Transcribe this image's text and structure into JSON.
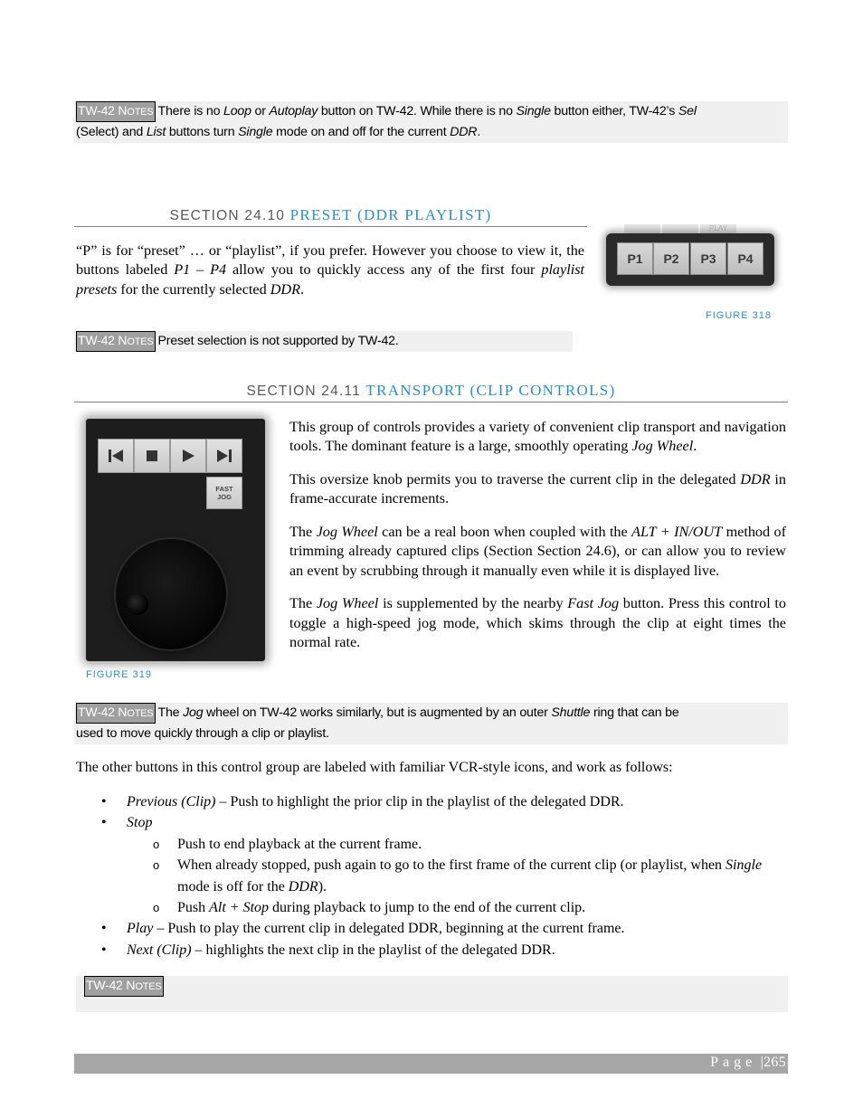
{
  "note_label": "TW-42 N",
  "note_label_sc": "OTES",
  "note1": {
    "t1": "There is no ",
    "i1": "Loop",
    "t2": " or ",
    "i2": "Autoplay",
    "t3": " button on TW-42.  While there is no ",
    "i3": "Single",
    "t4": " button either, TW-42’s ",
    "i4": "Sel",
    "t5": "(Select) and ",
    "i5": "List",
    "t6": " buttons turn ",
    "i6": "Single",
    "t7": " mode on and off for the current ",
    "i7": "DDR",
    "t8": "."
  },
  "section_2410": {
    "prefix": "SECTION 24.10 ",
    "title": "PRESET (DDR PLAYLIST)"
  },
  "preset_para": {
    "t1": "“P” is for “preset” … or “playlist”, if you prefer.  However you choose to view it, the buttons labeled ",
    "i1": "P1 – P4",
    "t2": " allow you to quickly access any of the first four ",
    "i2": "playlist presets",
    "t3": " for the currently selected ",
    "i3": "DDR",
    "t4": "."
  },
  "figure_318": {
    "caption": "FIGURE 318",
    "top_label": "PLAY",
    "buttons": [
      "P1",
      "P2",
      "P3",
      "P4"
    ]
  },
  "note2": {
    "text": "Preset selection is not supported by TW-42."
  },
  "section_2411": {
    "prefix": "SECTION 24.11 ",
    "title": "TRANSPORT (CLIP CONTROLS)"
  },
  "figure_319": {
    "caption": "FIGURE 319",
    "fast_jog_line1": "FAST",
    "fast_jog_line2": "JOG",
    "buttons": [
      "previous-icon",
      "stop-icon",
      "play-icon",
      "next-icon"
    ]
  },
  "transport_paras": {
    "p1_t1": "This group of controls provides a variety of convenient clip transport and navigation tools. The dominant feature is a large, smoothly operating ",
    "p1_i1": "Jog Wheel",
    "p1_t2": ".",
    "p2_t1": "This oversize knob permits you to traverse the current clip in the delegated ",
    "p2_i1": "DDR",
    "p2_t2": " in frame-accurate increments.",
    "p3_t1": "The ",
    "p3_i1": "Jog Wheel",
    "p3_t2": " can be a real boon when coupled with the ",
    "p3_i2": "ALT + IN/OUT",
    "p3_t3": " method of trimming already captured clips (Section Section 24.6), or can allow you to review an event by scrubbing through it manually even while it is displayed live.",
    "p4_t1": "The ",
    "p4_i1": "Jog Wheel",
    "p4_t2": " is supplemented by the nearby ",
    "p4_i2": "Fast Jog",
    "p4_t3": " button.  Press this control to toggle a high-speed jog mode, which skims through the clip at eight times the normal rate."
  },
  "note3": {
    "t1": "The ",
    "i1": "Jog",
    "t2": " wheel on TW-42 works similarly, but is augmented by an outer ",
    "i2": "Shuttle",
    "t3": " ring that can be",
    "t4": "used to move quickly through a clip or playlist."
  },
  "intro_list": "The other buttons in this control group are labeled with familiar VCR-style icons, and work as follows:",
  "list": {
    "b1_i": "Previous (Clip)",
    "b1_t": " – Push to highlight the prior clip in the playlist of the delegated DDR.",
    "b2_i": "Stop",
    "s1_t": "Push to end playback at the current frame.",
    "s2_t1": "When already stopped, push again to go to the first frame of the current clip (or playlist, when ",
    "s2_i1": "Single",
    "s2_t2": " mode is off for the ",
    "s2_i2": "DDR",
    "s2_t3": ").",
    "s3_t1": "Push ",
    "s3_i1": "Alt + Stop",
    "s3_t2": " during playback to jump to the end of the current clip.",
    "b3_i": "Play",
    "b3_t": " – Push to play the current clip in delegated DDR, beginning at the current frame.",
    "b4_i": "Next (Clip)",
    "b4_t": " – highlights the next clip in the playlist of the delegated DDR.",
    "bullet": "•",
    "sub_bullet": "o"
  },
  "footer": {
    "page_label": "Page",
    "separator": " |",
    "page_number": "265"
  }
}
